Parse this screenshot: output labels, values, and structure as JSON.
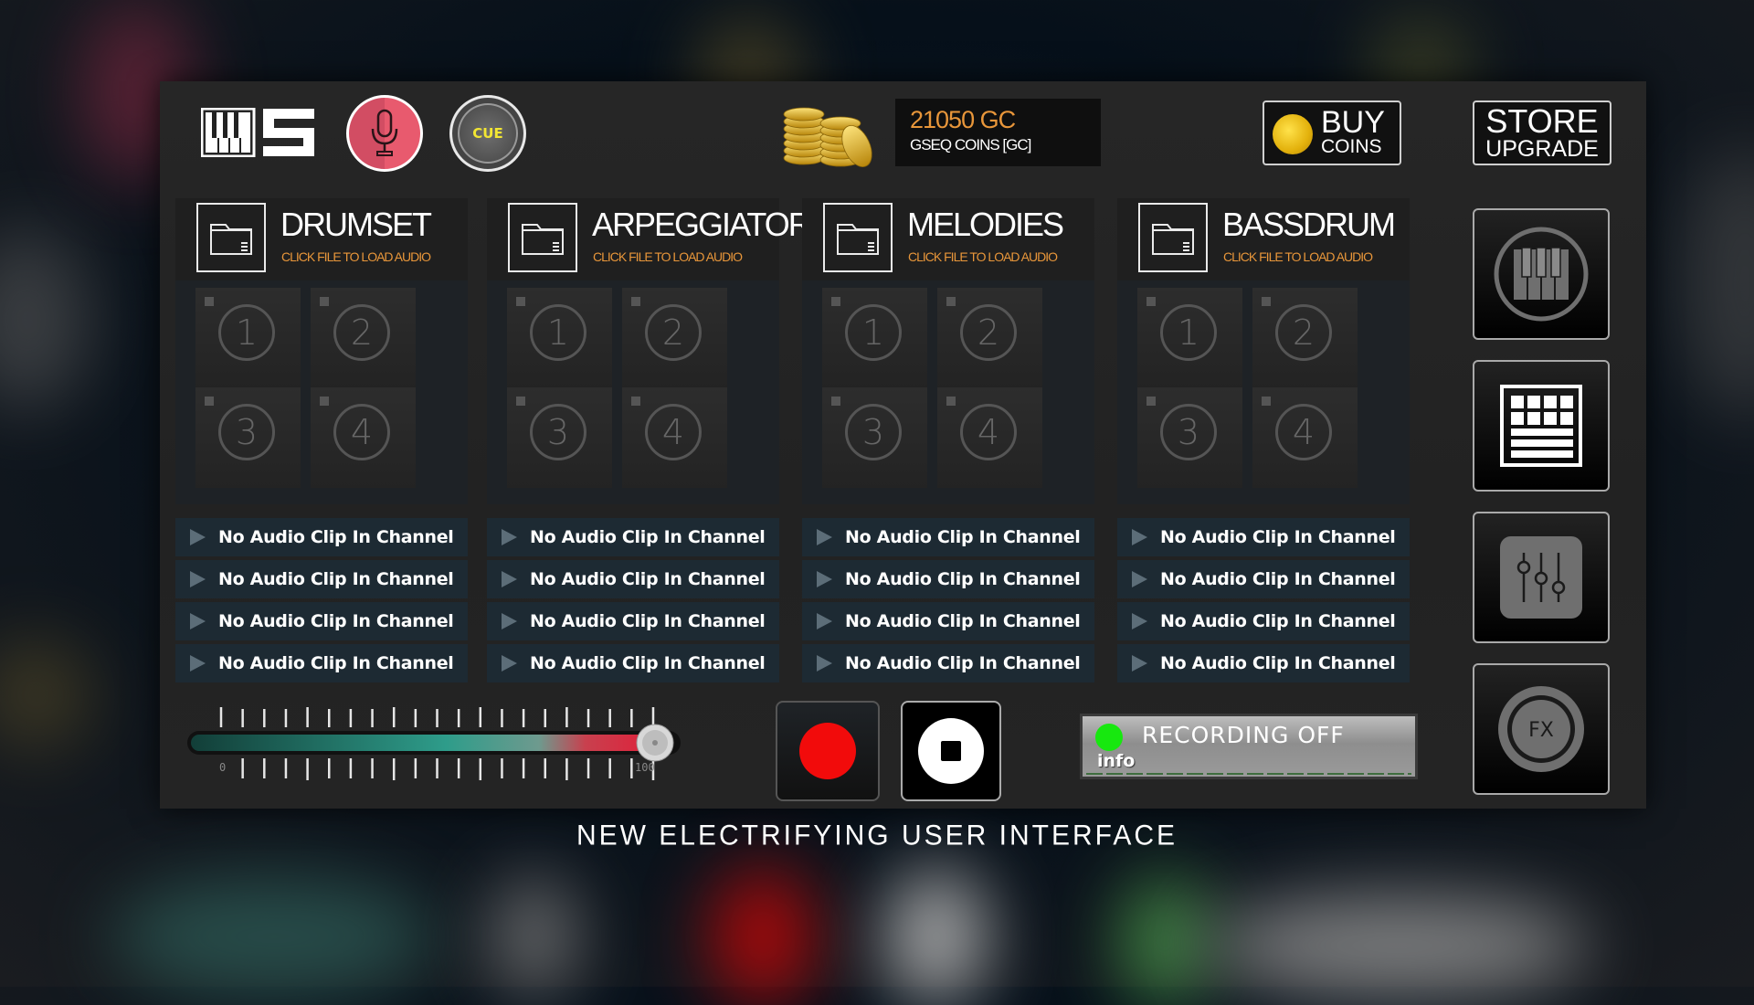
{
  "header": {
    "logo_alt": "GSEQ piano S logo",
    "mic_button_icon": "microphone-icon",
    "cue_button_label": "CUE",
    "coins": {
      "amount": "21050 GC",
      "label": "GSEQ COINS [GC]"
    },
    "buy_coins": {
      "line1": "BUY",
      "line2": "COINS"
    },
    "store_upgrade": {
      "line1": "STORE",
      "line2": "UPGRADE"
    }
  },
  "channels": [
    {
      "title": "DRUMSET",
      "subtitle": "CLICK FILE TO LOAD AUDIO",
      "pads": [
        "1",
        "2",
        "3",
        "4"
      ],
      "clips": [
        "No Audio Clip In Channel",
        "No Audio Clip In Channel",
        "No Audio Clip In Channel",
        "No Audio Clip In Channel"
      ]
    },
    {
      "title": "ARPEGGIATOR",
      "subtitle": "CLICK FILE TO LOAD AUDIO",
      "pads": [
        "1",
        "2",
        "3",
        "4"
      ],
      "clips": [
        "No Audio Clip In Channel",
        "No Audio Clip In Channel",
        "No Audio Clip In Channel",
        "No Audio Clip In Channel"
      ]
    },
    {
      "title": "MELODIES",
      "subtitle": "CLICK FILE TO LOAD AUDIO",
      "pads": [
        "1",
        "2",
        "3",
        "4"
      ],
      "clips": [
        "No Audio Clip In Channel",
        "No Audio Clip In Channel",
        "No Audio Clip In Channel",
        "No Audio Clip In Channel"
      ]
    },
    {
      "title": "BASSDRUM",
      "subtitle": "CLICK FILE TO LOAD AUDIO",
      "pads": [
        "1",
        "2",
        "3",
        "4"
      ],
      "clips": [
        "No Audio Clip In Channel",
        "No Audio Clip In Channel",
        "No Audio Clip In Channel",
        "No Audio Clip In Channel"
      ]
    }
  ],
  "side_buttons": [
    {
      "name": "piano",
      "icon": "piano-keys-icon"
    },
    {
      "name": "pad-grid",
      "icon": "pad-grid-icon"
    },
    {
      "name": "mixer",
      "icon": "mixer-sliders-icon"
    },
    {
      "name": "fx",
      "icon": "fx-icon",
      "label": "FX"
    }
  ],
  "volume_slider": {
    "min_label": "0",
    "max_label": "100",
    "value_percent": 100
  },
  "transport": {
    "record_icon": "record-icon",
    "stop_icon": "stop-icon"
  },
  "recording_display": {
    "status": "RECORDING  OFF",
    "info": "info",
    "led_color": "#17e80f"
  },
  "caption": "NEW ELECTRIFYING USER INTERFACE",
  "colors": {
    "accent_orange": "#e8963a",
    "cue_yellow": "#f2e633",
    "mic_red": "#e85a6e",
    "record_red": "#f20b0b",
    "slider_teal": "#2e9c8a",
    "slider_red": "#e0203a"
  }
}
